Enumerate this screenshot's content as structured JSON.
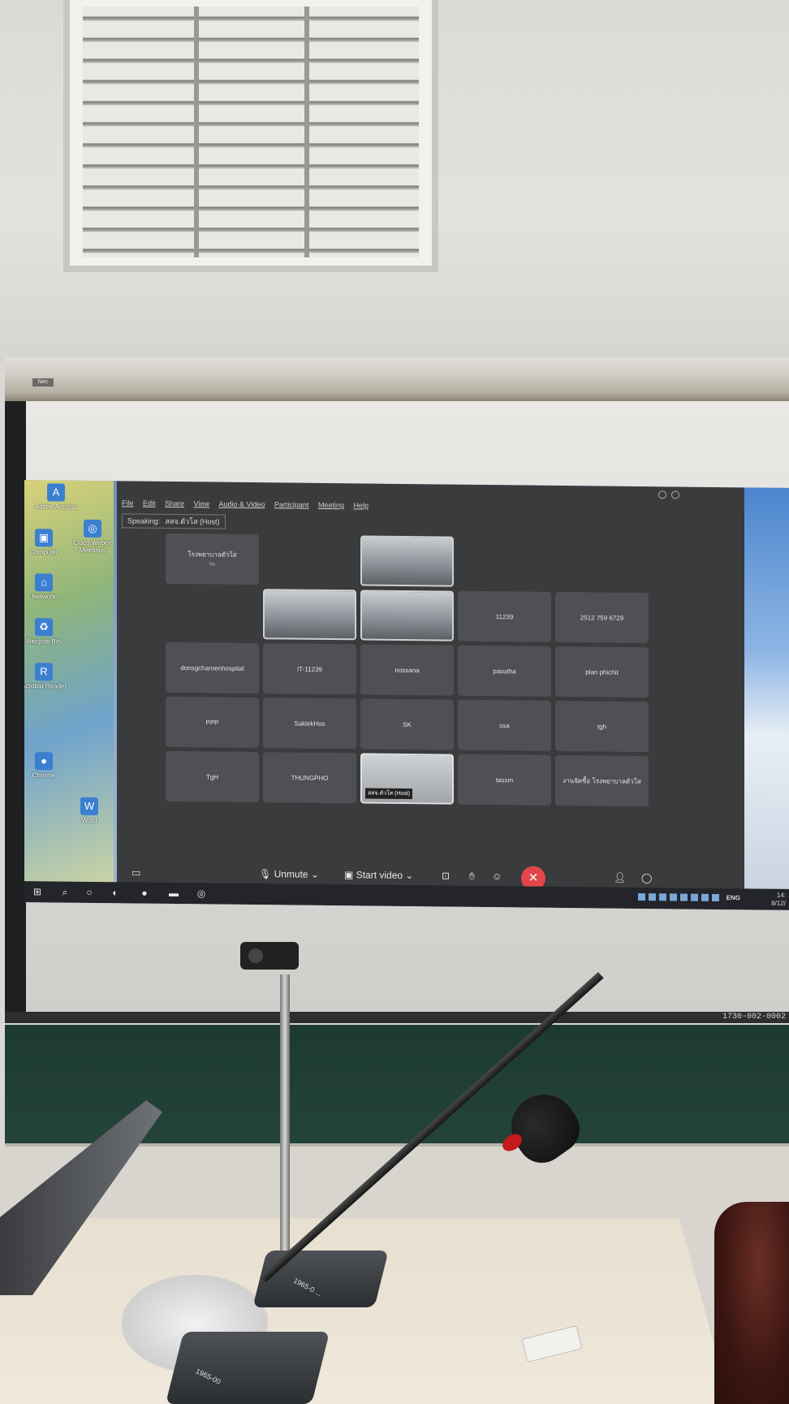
{
  "room": {
    "roller_label": "Nec",
    "screen_serial": "1730-002-0002",
    "mic_base_label_1": "1965-0 ...",
    "mic_base_label_2": "1965-00"
  },
  "desktop": {
    "icons": [
      {
        "label": "Adobe Acrobat",
        "icon": "pdf-icon"
      },
      {
        "label": "Cisco Webex Meetings",
        "icon": "webex-icon"
      },
      {
        "label": "Computer",
        "icon": "computer-icon"
      },
      {
        "label": "Network",
        "icon": "network-icon"
      },
      {
        "label": "Recycle Bin",
        "icon": "recycle-bin-icon"
      },
      {
        "label": "Acrobat Reader",
        "icon": "reader-icon"
      },
      {
        "label": "Chrome",
        "icon": "chrome-icon"
      },
      {
        "label": "Word",
        "icon": "word-icon"
      }
    ]
  },
  "webex": {
    "menu": [
      "File",
      "Edit",
      "Share",
      "View",
      "Audio & Video",
      "Participant",
      "Meeting",
      "Help"
    ],
    "speaking_label": "Speaking:",
    "speaking_name": "สสจ.ตัวโส (Host)",
    "tiles": [
      {
        "label": "โรงพยาบาลตัวโส",
        "sub": "ระ",
        "kind": "name"
      },
      {
        "label": "",
        "kind": "video"
      },
      {
        "label": "",
        "kind": "video"
      },
      {
        "label": "",
        "kind": "video"
      },
      {
        "label": "11239",
        "kind": "name"
      },
      {
        "label": "2512 759 6729",
        "kind": "name"
      },
      {
        "label": "donsgcharoenhospital",
        "kind": "name"
      },
      {
        "label": "IT-11239",
        "kind": "name"
      },
      {
        "label": "nossana",
        "kind": "name"
      },
      {
        "label": "pasutha",
        "kind": "name"
      },
      {
        "label": "plan phichit",
        "kind": "name"
      },
      {
        "label": "PPP",
        "kind": "name"
      },
      {
        "label": "SaklekHos",
        "kind": "name"
      },
      {
        "label": "SK",
        "kind": "name"
      },
      {
        "label": "ssa",
        "kind": "name"
      },
      {
        "label": "tgh",
        "kind": "name"
      },
      {
        "label": "TgH",
        "kind": "name"
      },
      {
        "label": "THUNGPHO",
        "kind": "name"
      },
      {
        "label": "สสจ.ตัวโส (Host)",
        "kind": "screen"
      },
      {
        "label": "tassm",
        "kind": "name"
      },
      {
        "label": "งานจัดซื้อ โรงพยาบาลตัวโส",
        "kind": "name"
      }
    ],
    "controls": {
      "unmute": "Unmute",
      "start_video": "Start video",
      "end_call_icon": "close-icon"
    }
  },
  "taskbar": {
    "lang": "ENG",
    "time": "14:",
    "date": "8/12/"
  }
}
